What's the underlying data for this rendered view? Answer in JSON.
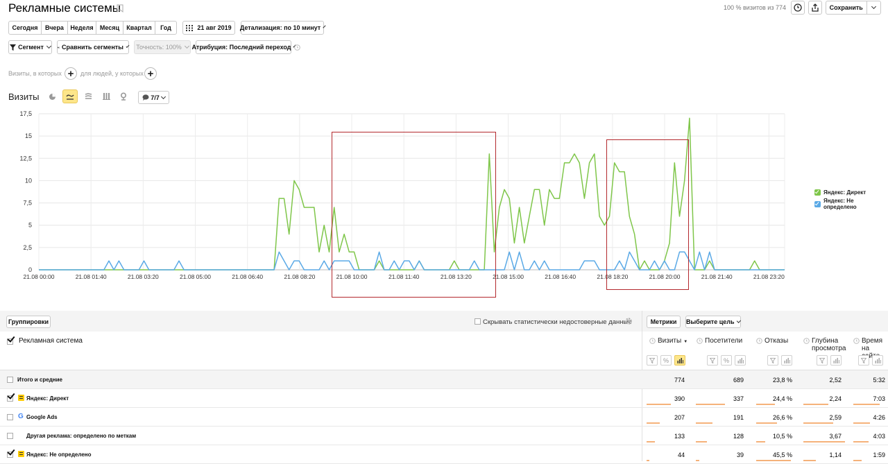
{
  "header": {
    "title": "Рекламные системы",
    "sampling": "100 % визитов из 774",
    "save_label": "Сохранить"
  },
  "periods": [
    "Сегодня",
    "Вчера",
    "Неделя",
    "Месяц",
    "Квартал",
    "Год"
  ],
  "date_label": "21 авг 2019",
  "detail_label": "Детализация: по 10 минут",
  "segment_label": "Сегмент",
  "compare_label": "Сравнить сегменты",
  "accuracy_label": "Точность: 100%",
  "attribution_label": "Атрибуция: Последний переход",
  "filter_visits": "Визиты, в которых",
  "filter_people": "для людей, у которых",
  "chart_title": "Визиты",
  "series_count": "7/7",
  "chart_data": {
    "type": "line",
    "ylim": [
      0,
      17.5
    ],
    "y_ticks": [
      "17,5",
      "15",
      "12,5",
      "10",
      "7,5",
      "5",
      "2,5",
      "0"
    ],
    "x_ticks": [
      "21.08 00:00",
      "21.08 01:40",
      "21.08 03:20",
      "21.08 05:00",
      "21.08 06:40",
      "21.08 08:20",
      "21.08 10:00",
      "21.08 11:40",
      "21.08 13:20",
      "21.08 15:00",
      "21.08 16:40",
      "21.08 18:20",
      "21.08 20:00",
      "21.08 21:40",
      "21.08 23:20"
    ],
    "legend_position": "right",
    "grid": true,
    "series": [
      {
        "name": "Яндекс: Директ",
        "color": "#7fc64a",
        "values": [
          0,
          0,
          0,
          0,
          0,
          0,
          0,
          0,
          0,
          0,
          0,
          0,
          0,
          0,
          0,
          0,
          0,
          0,
          0,
          0,
          0,
          0,
          0,
          0,
          0,
          0,
          0,
          0,
          0,
          0,
          0,
          0,
          0,
          0,
          0,
          0,
          0,
          0,
          0,
          0,
          0,
          0,
          0,
          0,
          0,
          0,
          0,
          0,
          8,
          8,
          4,
          10,
          9,
          7,
          7,
          7,
          2,
          5,
          2,
          7,
          2,
          4,
          2,
          2,
          0,
          0,
          0,
          0,
          1,
          0,
          0,
          0,
          0,
          0,
          0,
          0,
          1,
          0,
          0,
          0,
          0,
          0,
          0,
          1,
          0,
          0,
          0,
          0,
          0,
          0,
          13,
          2,
          7,
          9,
          8,
          3,
          7,
          3,
          6,
          9,
          9,
          5,
          9,
          8,
          8,
          12,
          12,
          13,
          12,
          8,
          12,
          13,
          6,
          5,
          6,
          12,
          11,
          11,
          6,
          4,
          0,
          1,
          0,
          0,
          0,
          1,
          3,
          12,
          6,
          10,
          17,
          0,
          0,
          0,
          1,
          0,
          0,
          0,
          0,
          0,
          0,
          0,
          0,
          1,
          0,
          0,
          0,
          0,
          0,
          0
        ]
      },
      {
        "name": "Яндекс: Не определено",
        "color": "#5aa9e6",
        "values": [
          0,
          0,
          0,
          0,
          0,
          0,
          0,
          0,
          0,
          0,
          0,
          0,
          0,
          0,
          1,
          0,
          1,
          0,
          0,
          0,
          0,
          1,
          0,
          0,
          0,
          0,
          0,
          0,
          1,
          0,
          0,
          0,
          0,
          0,
          0,
          0,
          0,
          0,
          0,
          0,
          0,
          0,
          0,
          0,
          0,
          0,
          0,
          0,
          2,
          1,
          0,
          1,
          1,
          0,
          0,
          0,
          0,
          1,
          0,
          1,
          1,
          1,
          1,
          0,
          0,
          0,
          0,
          0,
          2,
          0,
          0,
          1,
          0,
          1,
          1,
          0,
          1,
          0,
          0,
          0,
          0,
          0,
          0,
          0,
          0,
          0,
          0,
          1,
          0,
          0,
          0,
          0,
          0,
          0,
          2,
          0,
          2,
          0,
          0,
          1,
          0,
          1,
          0,
          0,
          0,
          0,
          0,
          0,
          0,
          1,
          1,
          1,
          0,
          0,
          0,
          0,
          1,
          0,
          2,
          1,
          0,
          0,
          0,
          1,
          0,
          1,
          0,
          0,
          2,
          2,
          1,
          0,
          2,
          0,
          2,
          0,
          0,
          0,
          0,
          0,
          0,
          0,
          0,
          0,
          0,
          0,
          0,
          0,
          0,
          0
        ]
      }
    ]
  },
  "table": {
    "groupings_label": "Группировки",
    "hide_unreliable": "Скрывать статистически недостоверные данные",
    "metrics_label": "Метрики",
    "goal_label": "Выберите цель",
    "dimension_header": "Рекламная система",
    "columns": [
      "Визиты",
      "Посетители",
      "Отказы",
      "Глубина просмотра",
      "Время на сайте"
    ],
    "rows": [
      {
        "name": "Итого и средние",
        "values": [
          "774",
          "689",
          "23,8 %",
          "2,52",
          "5:32"
        ],
        "checked": false,
        "icon": "none",
        "fills": [
          0,
          0,
          0,
          0,
          0
        ]
      },
      {
        "name": "Яндекс: Директ",
        "values": [
          "390",
          "337",
          "24,4 %",
          "2,24",
          "7:03"
        ],
        "checked": true,
        "icon": "yandex-direct-icon",
        "fills": [
          0.5039,
          0.4891,
          0.4,
          0.5,
          0.8
        ]
      },
      {
        "name": "Google Ads",
        "values": [
          "207",
          "191",
          "26,6 %",
          "2,59",
          "4:26"
        ],
        "checked": false,
        "icon": "google-icon",
        "fills": [
          0.2674,
          0.2772,
          0.45,
          0.6,
          0.5
        ]
      },
      {
        "name": "Другая реклама: определено по меткам",
        "values": [
          "133",
          "128",
          "10,5 %",
          "3,67",
          "4:03"
        ],
        "checked": false,
        "icon": "none",
        "fills": [
          0.1718,
          0.1858,
          0.2,
          0.85,
          0.45
        ]
      },
      {
        "name": "Яндекс: Не определено",
        "values": [
          "44",
          "39",
          "45,5 %",
          "1,14",
          "1:59"
        ],
        "checked": true,
        "icon": "yandex-direct-icon",
        "fills": [
          0.0568,
          0.0566,
          0.75,
          0.25,
          0.25
        ]
      }
    ]
  }
}
